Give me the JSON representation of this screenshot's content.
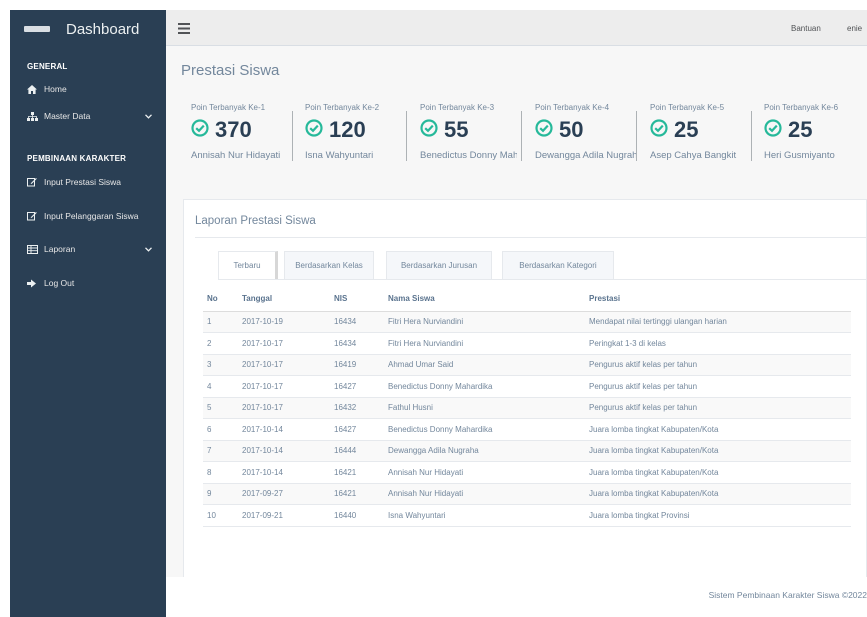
{
  "sidebar": {
    "brand": "Dashboard",
    "section_general": "GENERAL",
    "home": "Home",
    "master_data": "Master Data",
    "section_pembinaan": "PEMBINAAN KARAKTER",
    "input_prestasi": "Input Prestasi Siswa",
    "input_pelanggaran": "Input Pelanggaran Siswa",
    "laporan": "Laporan",
    "logout": "Log Out"
  },
  "topbar": {
    "help": "Bantuan",
    "user": "enie"
  },
  "page_title": "Prestasi Siswa",
  "tiles": [
    {
      "label": "Poin Terbanyak Ke-1",
      "count": "370",
      "name": "Annisah Nur Hidayati"
    },
    {
      "label": "Poin Terbanyak Ke-2",
      "count": "120",
      "name": "Isna Wahyuntari"
    },
    {
      "label": "Poin Terbanyak Ke-3",
      "count": "55",
      "name": "Benedictus Donny Mahardika"
    },
    {
      "label": "Poin Terbanyak Ke-4",
      "count": "50",
      "name": "Dewangga Adila Nugraha"
    },
    {
      "label": "Poin Terbanyak Ke-5",
      "count": "25",
      "name": "Asep Cahya Bangkit"
    },
    {
      "label": "Poin Terbanyak Ke-6",
      "count": "25",
      "name": "Heri Gusmiyanto"
    }
  ],
  "report": {
    "title": "Laporan Prestasi Siswa",
    "tabs": [
      "Terbaru",
      "Berdasarkan Kelas",
      "Berdasarkan Jurusan",
      "Berdasarkan Kategori"
    ],
    "columns": [
      "No",
      "Tanggal",
      "NIS",
      "Nama Siswa",
      "Prestasi"
    ],
    "rows": [
      [
        "1",
        "2017-10-19",
        "16434",
        "Fitri Hera Nurviandini",
        "Mendapat nilai tertinggi ulangan harian"
      ],
      [
        "2",
        "2017-10-17",
        "16434",
        "Fitri Hera Nurviandini",
        "Peringkat 1-3 di kelas"
      ],
      [
        "3",
        "2017-10-17",
        "16419",
        "Ahmad Umar Said",
        "Pengurus aktif kelas per tahun"
      ],
      [
        "4",
        "2017-10-17",
        "16427",
        "Benedictus Donny Mahardika",
        "Pengurus aktif kelas per tahun"
      ],
      [
        "5",
        "2017-10-17",
        "16432",
        "Fathul Husni",
        "Pengurus aktif kelas per tahun"
      ],
      [
        "6",
        "2017-10-14",
        "16427",
        "Benedictus Donny Mahardika",
        "Juara lomba tingkat Kabupaten/Kota"
      ],
      [
        "7",
        "2017-10-14",
        "16444",
        "Dewangga Adila Nugraha",
        "Juara lomba tingkat Kabupaten/Kota"
      ],
      [
        "8",
        "2017-10-14",
        "16421",
        "Annisah Nur Hidayati",
        "Juara lomba tingkat Kabupaten/Kota"
      ],
      [
        "9",
        "2017-09-27",
        "16421",
        "Annisah Nur Hidayati",
        "Juara lomba tingkat Kabupaten/Kota"
      ],
      [
        "10",
        "2017-09-21",
        "16440",
        "Isna Wahyuntari",
        "Juara lomba tingkat Provinsi"
      ]
    ]
  },
  "footer": "Sistem Pembinaan Karakter Siswa ©2022",
  "colors": {
    "sidebar": "#2a3f54",
    "accent": "#26b99a",
    "text": "#73879c"
  },
  "icons": [
    "home-icon",
    "sitemap-icon",
    "edit-icon",
    "table-icon",
    "sign-out-icon",
    "chevron-down-icon",
    "menu-icon",
    "check-circle-icon"
  ]
}
